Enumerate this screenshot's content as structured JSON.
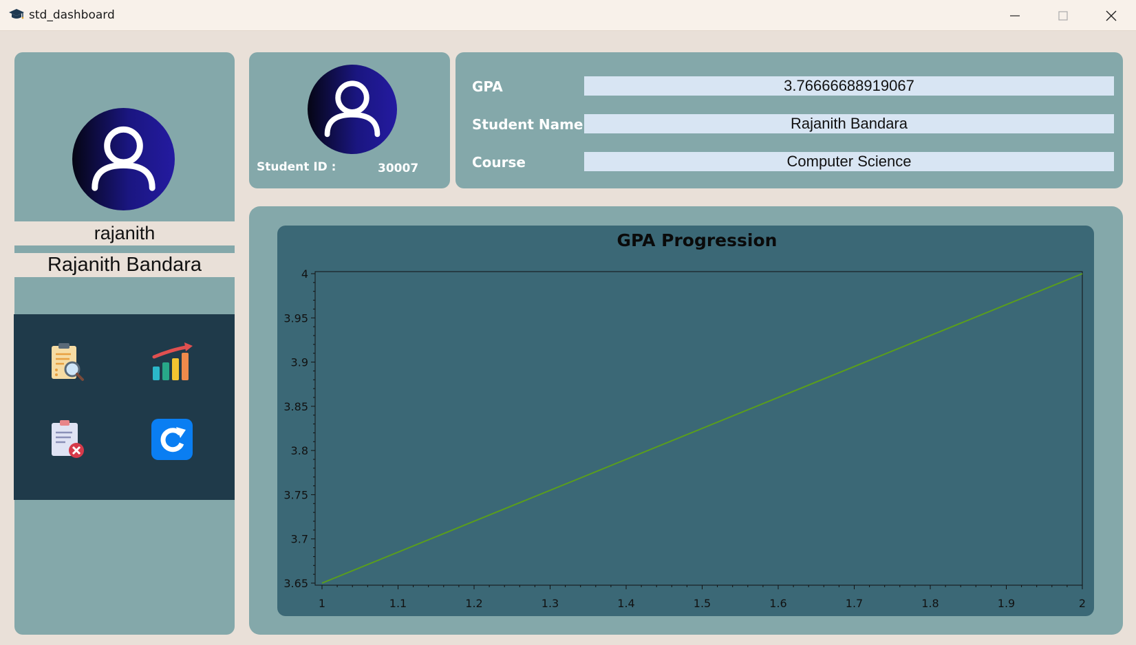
{
  "window": {
    "title": "std_dashboard",
    "app_icon": "graduation-cap-icon"
  },
  "sidebar": {
    "username": "rajanith",
    "full_name": "Rajanith Bandara",
    "menu": [
      {
        "icon": "report-search-icon"
      },
      {
        "icon": "progress-chart-icon"
      },
      {
        "icon": "delete-record-icon"
      },
      {
        "icon": "refresh-icon"
      }
    ]
  },
  "id_card": {
    "label": "Student ID :",
    "value": "30007"
  },
  "info": {
    "gpa_label": "GPA",
    "gpa_value": "3.76666688919067",
    "name_label": "Student Name",
    "name_value": "Rajanith Bandara",
    "course_label": "Course",
    "course_value": "Computer Science"
  },
  "colors": {
    "panel": "#84a8aa",
    "chart_bg": "#3b6876",
    "menu_bg": "#1f3a4a",
    "line": "#5a9e1c",
    "field": "#d8e5f3"
  },
  "chart_data": {
    "type": "line",
    "title": "GPA Progression",
    "xlabel": "",
    "ylabel": "",
    "xlim": [
      1,
      2
    ],
    "ylim": [
      3.65,
      4
    ],
    "xticks": [
      "1",
      "1.1",
      "1.2",
      "1.3",
      "1.4",
      "1.5",
      "1.6",
      "1.7",
      "1.8",
      "1.9",
      "2"
    ],
    "yticks": [
      "3.65",
      "3.7",
      "3.75",
      "3.8",
      "3.85",
      "3.9",
      "3.95",
      "4"
    ],
    "series": [
      {
        "x": [
          1,
          2
        ],
        "y": [
          3.65,
          4
        ]
      }
    ],
    "grid": false,
    "legend": "none"
  }
}
